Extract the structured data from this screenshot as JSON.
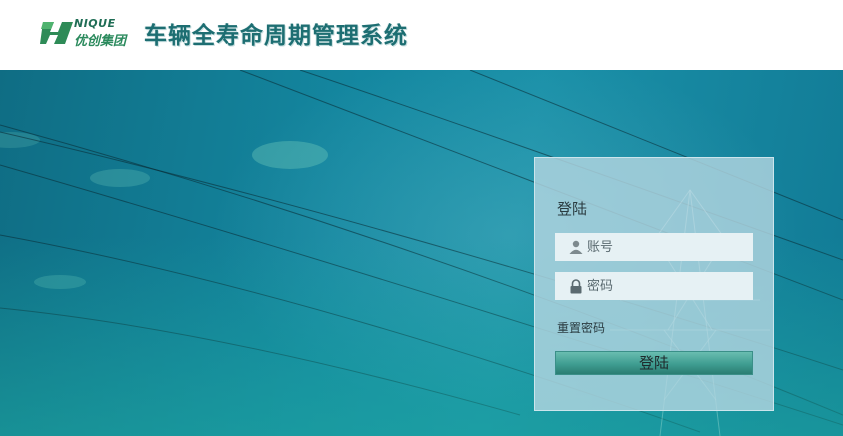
{
  "header": {
    "logo_word": "NIQUE",
    "logo_cn": "优创集团",
    "system_title": "车辆全寿命周期管理系统"
  },
  "login": {
    "title": "登陆",
    "account_placeholder": "账号",
    "password_placeholder": "密码",
    "reset_password_label": "重置密码",
    "submit_label": "登陆"
  },
  "icons": {
    "account": "user-icon",
    "password": "lock-icon"
  },
  "colors": {
    "title": "#1d6e72",
    "banner": "#1487a0",
    "button": "#3f9d91",
    "panel": "#b2d6e0"
  }
}
